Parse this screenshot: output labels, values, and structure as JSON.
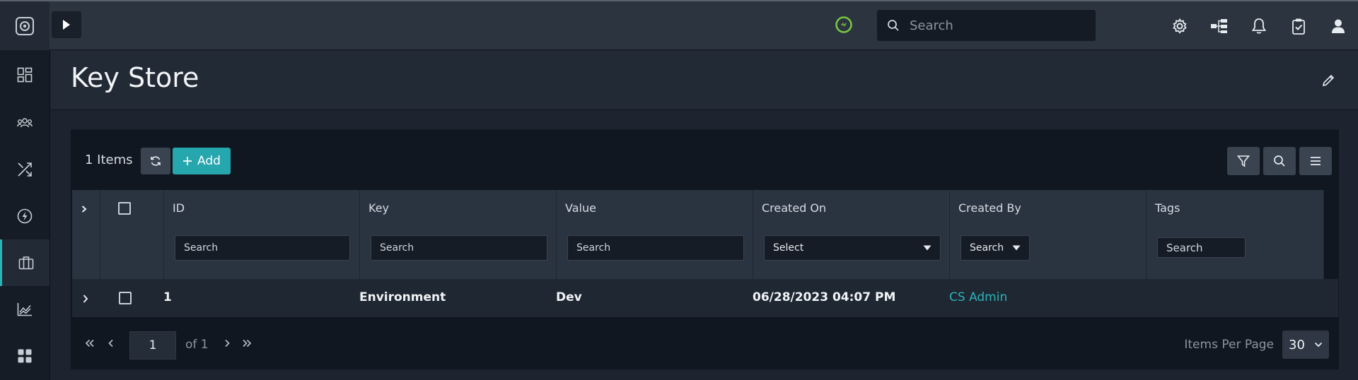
{
  "topbar": {
    "search_placeholder": "Search"
  },
  "header": {
    "title": "Key Store"
  },
  "toolbar": {
    "count": "1 Items",
    "add_label": "Add"
  },
  "columns": [
    {
      "title": "ID",
      "search": "Search"
    },
    {
      "title": "Key",
      "search": "Search"
    },
    {
      "title": "Value",
      "search": "Search"
    },
    {
      "title": "Created On",
      "select": "Select"
    },
    {
      "title": "Created By",
      "select": "Search"
    },
    {
      "title": "Tags",
      "search": "Search"
    }
  ],
  "rows": [
    {
      "id": "1",
      "key": "Environment",
      "value": "Dev",
      "created_on": "06/28/2023 04:07 PM",
      "created_by": "CS Admin",
      "tags": ""
    }
  ],
  "pagination": {
    "page": "1",
    "of_text": "of 1",
    "items_per_page_label": "Items Per Page",
    "items_per_page": "30"
  },
  "colors": {
    "accent": "#26a6ad",
    "status_ok": "#7ac943"
  }
}
